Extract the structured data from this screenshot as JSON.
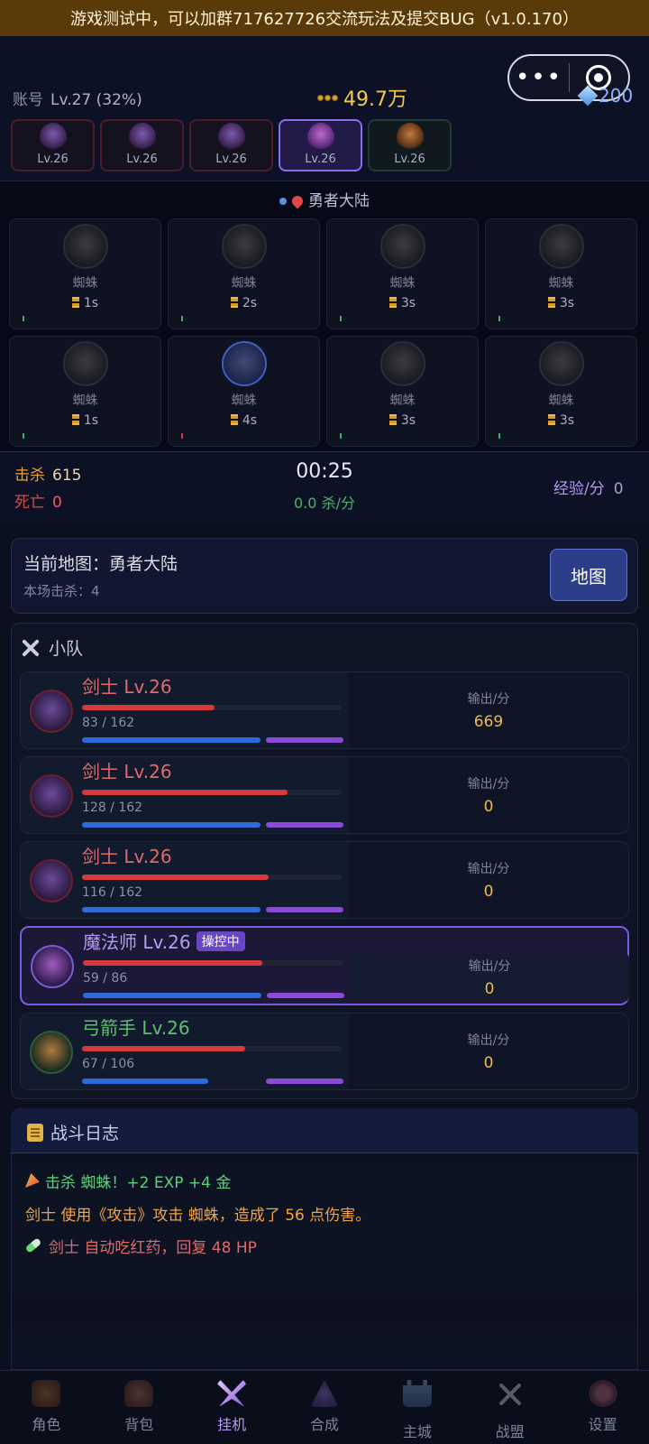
{
  "banner": "游戏测试中，可以加群717627726交流玩法及提交BUG（v1.0.170）",
  "header": {
    "account_label": "账号",
    "account_level": "Lv.27 (32%)",
    "gold": "49.7万",
    "diamonds": "200",
    "heroes": [
      {
        "level": "Lv.26",
        "type": "swordsman"
      },
      {
        "level": "Lv.26",
        "type": "swordsman"
      },
      {
        "level": "Lv.26",
        "type": "swordsman"
      },
      {
        "level": "Lv.26",
        "type": "mage",
        "selected": true
      },
      {
        "level": "Lv.26",
        "type": "archer"
      }
    ]
  },
  "zone": {
    "name": "勇者大陆",
    "monsters": [
      {
        "name": "蜘蛛",
        "time": "1s"
      },
      {
        "name": "蜘蛛",
        "time": "2s"
      },
      {
        "name": "蜘蛛",
        "time": "3s"
      },
      {
        "name": "蜘蛛",
        "time": "3s"
      },
      {
        "name": "蜘蛛",
        "time": "1s"
      },
      {
        "name": "蜘蛛",
        "time": "4s",
        "highlighted": true
      },
      {
        "name": "蜘蛛",
        "time": "3s"
      },
      {
        "name": "蜘蛛",
        "time": "3s"
      }
    ]
  },
  "stats": {
    "kill_label": "击杀",
    "kill_value": "615",
    "death_label": "死亡",
    "death_value": "0",
    "timer": "00:25",
    "rate": "0.0 杀/分",
    "exp_label": "经验/分",
    "exp_value": "0"
  },
  "map": {
    "current": "当前地图：勇者大陆",
    "session_kills": "本场击杀：4",
    "button": "地图"
  },
  "team": {
    "title": "小队",
    "output_label": "输出/分",
    "members": [
      {
        "name": "剑士 Lv.26",
        "hp": "83 / 162",
        "hp_fraction": 0.51,
        "output": "669"
      },
      {
        "name": "剑士 Lv.26",
        "hp": "128 / 162",
        "hp_fraction": 0.79,
        "output": "0"
      },
      {
        "name": "剑士 Lv.26",
        "hp": "116 / 162",
        "hp_fraction": 0.72,
        "output": "0"
      },
      {
        "name": "魔法师 Lv.26",
        "hp": "59 / 86",
        "hp_fraction": 0.69,
        "output": "0",
        "tag": "操控中"
      },
      {
        "name": "弓箭手 Lv.26",
        "hp": "67 / 106",
        "hp_fraction": 0.63,
        "output": "0"
      }
    ]
  },
  "log": {
    "title": "战斗日志",
    "lines": [
      "击杀 蜘蛛！+2 EXP +4 金",
      "剑士 使用《攻击》攻击 蜘蛛，造成了 56 点伤害。",
      "剑士 自动吃红药，回复 48 HP"
    ]
  },
  "tabs": [
    {
      "label": "角色",
      "icon": "character-icon"
    },
    {
      "label": "背包",
      "icon": "bag-icon"
    },
    {
      "label": "挂机",
      "icon": "idle-icon",
      "active": true
    },
    {
      "label": "合成",
      "icon": "craft-icon"
    },
    {
      "label": "主城",
      "icon": "castle-icon"
    },
    {
      "label": "战盟",
      "icon": "crossed-swords-icon"
    },
    {
      "label": "设置",
      "icon": "gear-icon"
    }
  ],
  "colors": {
    "accent": "#8b6ef0",
    "gold": "#f2c94c",
    "hp": "#d63a3a",
    "mp": "#2e6ad8",
    "xp": "#8c4ad8",
    "banner_bg": "#5b3a0a"
  }
}
